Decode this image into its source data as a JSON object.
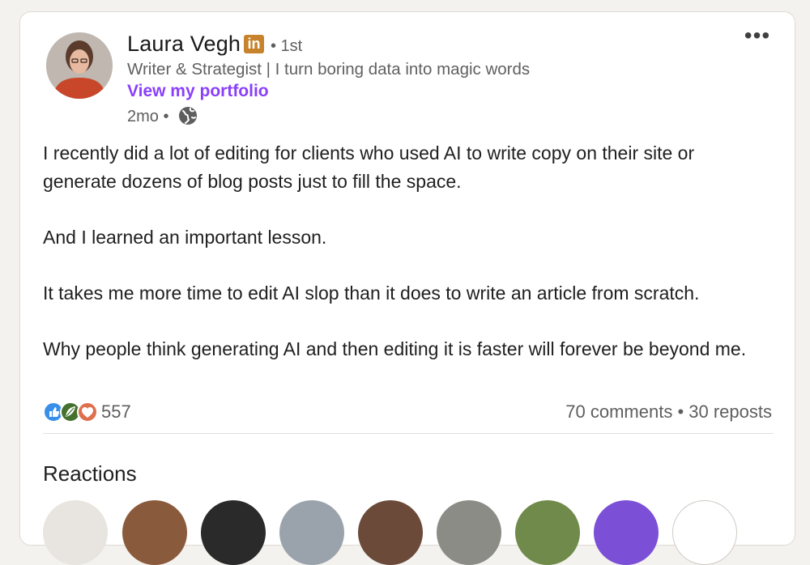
{
  "post": {
    "author": {
      "name": "Laura Vegh",
      "badge": "in",
      "degree": "• 1st",
      "headline": "Writer & Strategist | I turn boring data into magic words",
      "link_text": "View my portfolio",
      "time": "2mo •",
      "visibility_icon": "globe-icon"
    },
    "menu_label": "•••",
    "body": [
      "I recently did a lot of editing for clients who used AI to write copy on their site or generate dozens of blog posts just to fill the space.",
      "And I learned an important lesson.",
      "It takes me more time to edit AI slop than it does to write an article from scratch.",
      "Why people think generating AI and then editing it is faster will forever be beyond me."
    ],
    "reactions": {
      "icons": [
        "like-icon",
        "insightful-icon",
        "love-icon"
      ],
      "count": "557"
    },
    "comments": "70 comments",
    "separator": " • ",
    "reposts": "30 reposts"
  },
  "reactions_section": {
    "title": "Reactions"
  },
  "colors": {
    "link": "#8a3ffc",
    "linkedin_badge": "#c7822b",
    "like": "#378fe9",
    "insightful": "#44712e",
    "love": "#df704d"
  }
}
